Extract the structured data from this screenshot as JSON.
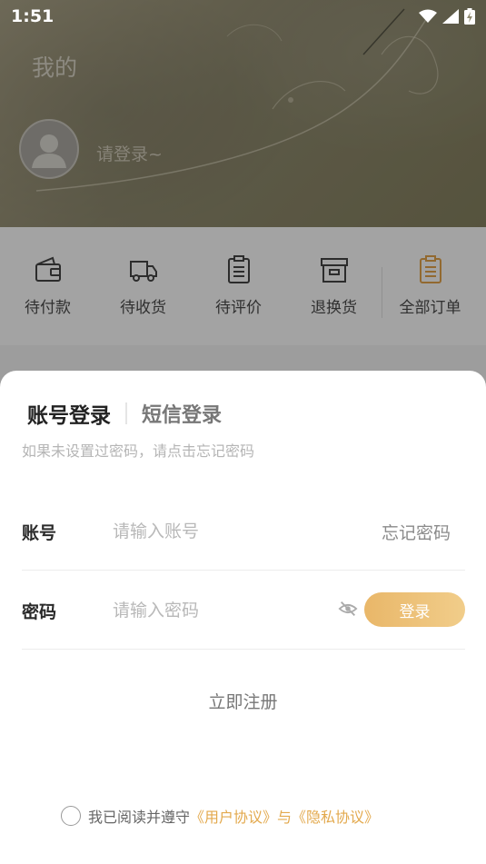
{
  "status_bar": {
    "time": "1:51"
  },
  "page": {
    "title": "我的",
    "login_hint": "请登录~"
  },
  "orders": [
    {
      "label": "待付款",
      "icon": "wallet-icon"
    },
    {
      "label": "待收货",
      "icon": "truck-icon"
    },
    {
      "label": "待评价",
      "icon": "clipboard-icon"
    },
    {
      "label": "退换货",
      "icon": "archive-box-icon"
    },
    {
      "label": "全部订单",
      "icon": "order-list-icon"
    }
  ],
  "login_sheet": {
    "tab_account": "账号登录",
    "tab_sms": "短信登录",
    "hint": "如果未设置过密码，请点击忘记密码",
    "account_label": "账号",
    "account_placeholder": "请输入账号",
    "forgot_password": "忘记密码",
    "password_label": "密码",
    "password_placeholder": "请输入密码",
    "login_button": "登录",
    "register": "立即注册",
    "agreement_prefix": "我已阅读并遵守",
    "user_agreement": "《用户协议》",
    "agreement_and": "与",
    "privacy_agreement": "《隐私协议》"
  },
  "colors": {
    "accent": "#e9b769",
    "link": "#e3a94d"
  }
}
